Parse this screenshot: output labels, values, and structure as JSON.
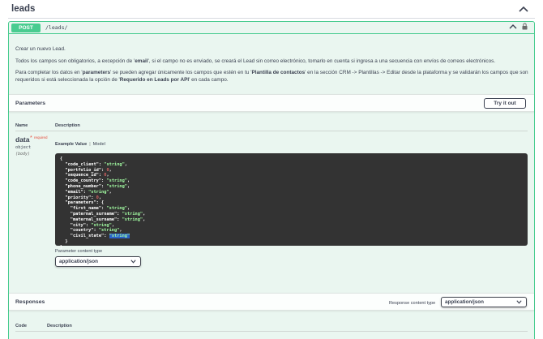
{
  "tag": {
    "title": "leads"
  },
  "operation": {
    "method": "POST",
    "path": "/leads/"
  },
  "description": {
    "summary": "Crear un nuevo Lead.",
    "line2": {
      "pre": "Todos los campos son obligatorios, a excepción de '",
      "bold": "email",
      "post": "', si el campo no es enviado, se creará el Lead sin correo electrónico, tomarlo en cuenta si ingresa a una secuencia con envíos de correos electrónicos."
    },
    "line3": {
      "p1": "Para completar los datos en '",
      "b1": "parameters",
      "p2": "' se pueden agregar únicamente los campos que estén en tu '",
      "b2": "Plantilla de contactos",
      "p3": "' en la sección CRM -> Plantillas -> Editar desde la plataforma y se validarán los campos que son requeridos si está seleccionada la opción de '",
      "b3": "Requerido en Leads por API",
      "p4": "' en cada campo."
    }
  },
  "parameters": {
    "title": "Parameters",
    "try_it_out": "Try it out",
    "col_name": "Name",
    "col_description": "Description",
    "param": {
      "name": "data",
      "star": "*",
      "required": "required",
      "type": "object",
      "in": "(body)"
    },
    "example_tabs": {
      "example": "Example Value",
      "sep": "|",
      "model": "Model"
    },
    "content_type_label": "Parameter content type",
    "content_type_value": "application/json"
  },
  "responses": {
    "title": "Responses",
    "content_type_label": "Response content type",
    "content_type_value": "application/json",
    "col_code": "Code",
    "col_description": "Description"
  },
  "colors": {
    "post_green": "#49cc90",
    "opblock_bg": "#eaf6f0",
    "code_bg": "#333333"
  },
  "icons": {
    "tag_toggle": "chevron-up-icon",
    "summary_toggle": "chevron-up-icon",
    "lock": "lock-icon",
    "select_caret": "chevron-down-icon"
  }
}
